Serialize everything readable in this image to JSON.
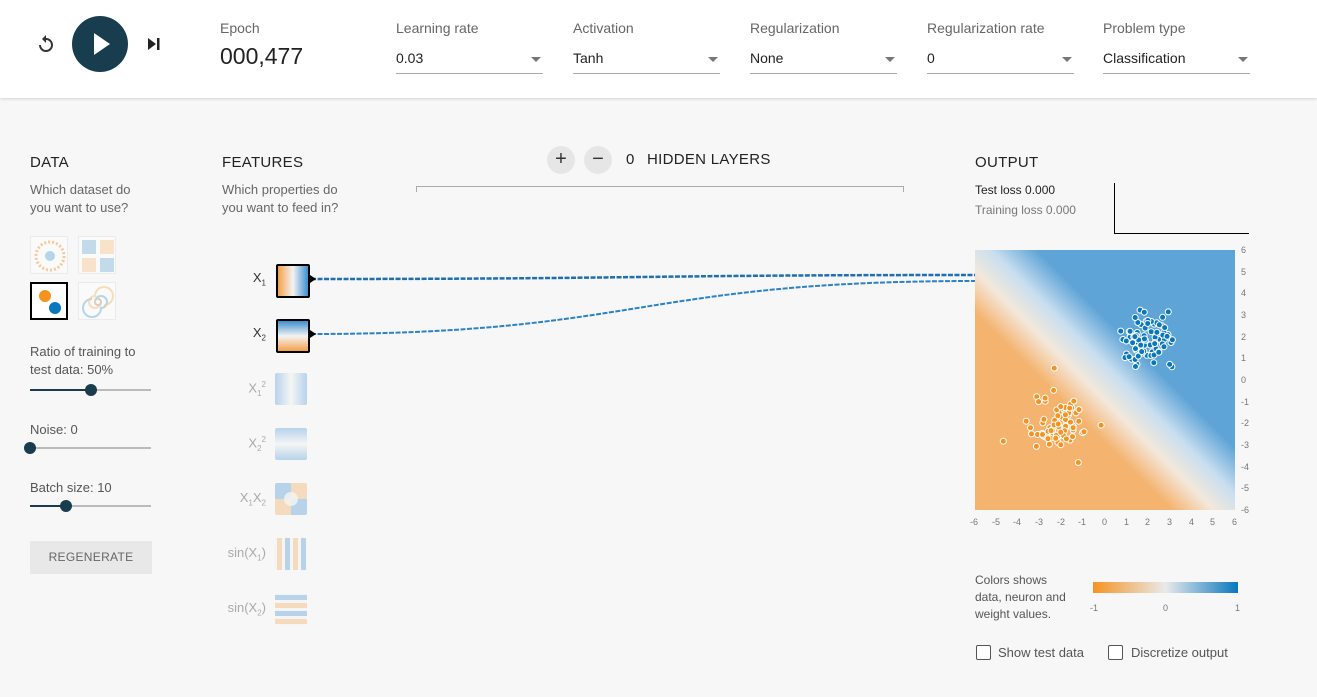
{
  "header": {
    "epoch_label": "Epoch",
    "epoch_value": "000,477",
    "learning_rate": {
      "label": "Learning rate",
      "value": "0.03"
    },
    "activation": {
      "label": "Activation",
      "value": "Tanh"
    },
    "regularization": {
      "label": "Regularization",
      "value": "None"
    },
    "regularization_rate": {
      "label": "Regularization rate",
      "value": "0"
    },
    "problem_type": {
      "label": "Problem type",
      "value": "Classification"
    }
  },
  "data_panel": {
    "heading": "DATA",
    "question": [
      "Which dataset do",
      "you want to use?"
    ],
    "ratio_label": [
      "Ratio of training to",
      "test data:  50%"
    ],
    "ratio_value": 0.5,
    "noise_label": "Noise:  0",
    "noise_value": 0,
    "batch_label": "Batch size:  10",
    "batch_value": 0.3,
    "regenerate": "REGENERATE"
  },
  "features_panel": {
    "heading": "FEATURES",
    "question": [
      "Which properties do",
      "you want to feed in?"
    ],
    "features": [
      {
        "label": "X",
        "sub": "1",
        "sup": "",
        "active": true
      },
      {
        "label": "X",
        "sub": "2",
        "sup": "",
        "active": true
      },
      {
        "label": "X",
        "sub": "1",
        "sup": "2",
        "active": false
      },
      {
        "label": "X",
        "sub": "2",
        "sup": "2",
        "active": false
      },
      {
        "label": "X X",
        "sub": "1 2",
        "sup": "",
        "active": false
      },
      {
        "label": "sin(X )",
        "sub": "1",
        "sup": "",
        "active": false
      },
      {
        "label": "sin(X )",
        "sub": "2",
        "sup": "",
        "active": false
      }
    ]
  },
  "network": {
    "plus": "+",
    "minus": "−",
    "layer_count": "0",
    "layers_label": "HIDDEN LAYERS"
  },
  "output_panel": {
    "heading": "OUTPUT",
    "test_loss": "Test loss 0.000",
    "training_loss": "Training loss 0.000",
    "x_ticks": [
      "-6",
      "-5",
      "-4",
      "-3",
      "-2",
      "-1",
      "0",
      "1",
      "2",
      "3",
      "4",
      "5",
      "6"
    ],
    "y_ticks": [
      "6",
      "5",
      "4",
      "3",
      "2",
      "1",
      "0",
      "-1",
      "-2",
      "-3",
      "-4",
      "-5",
      "-6"
    ],
    "legend_text": [
      "Colors shows",
      "data, neuron and",
      "weight values."
    ],
    "legend_ticks": [
      "-1",
      "0",
      "1"
    ],
    "show_test_data": "Show test data",
    "discretize_output": "Discretize output"
  },
  "colors": {
    "dark_accent": "#183d4e",
    "orange": "#f59322",
    "blue": "#0877bd"
  }
}
